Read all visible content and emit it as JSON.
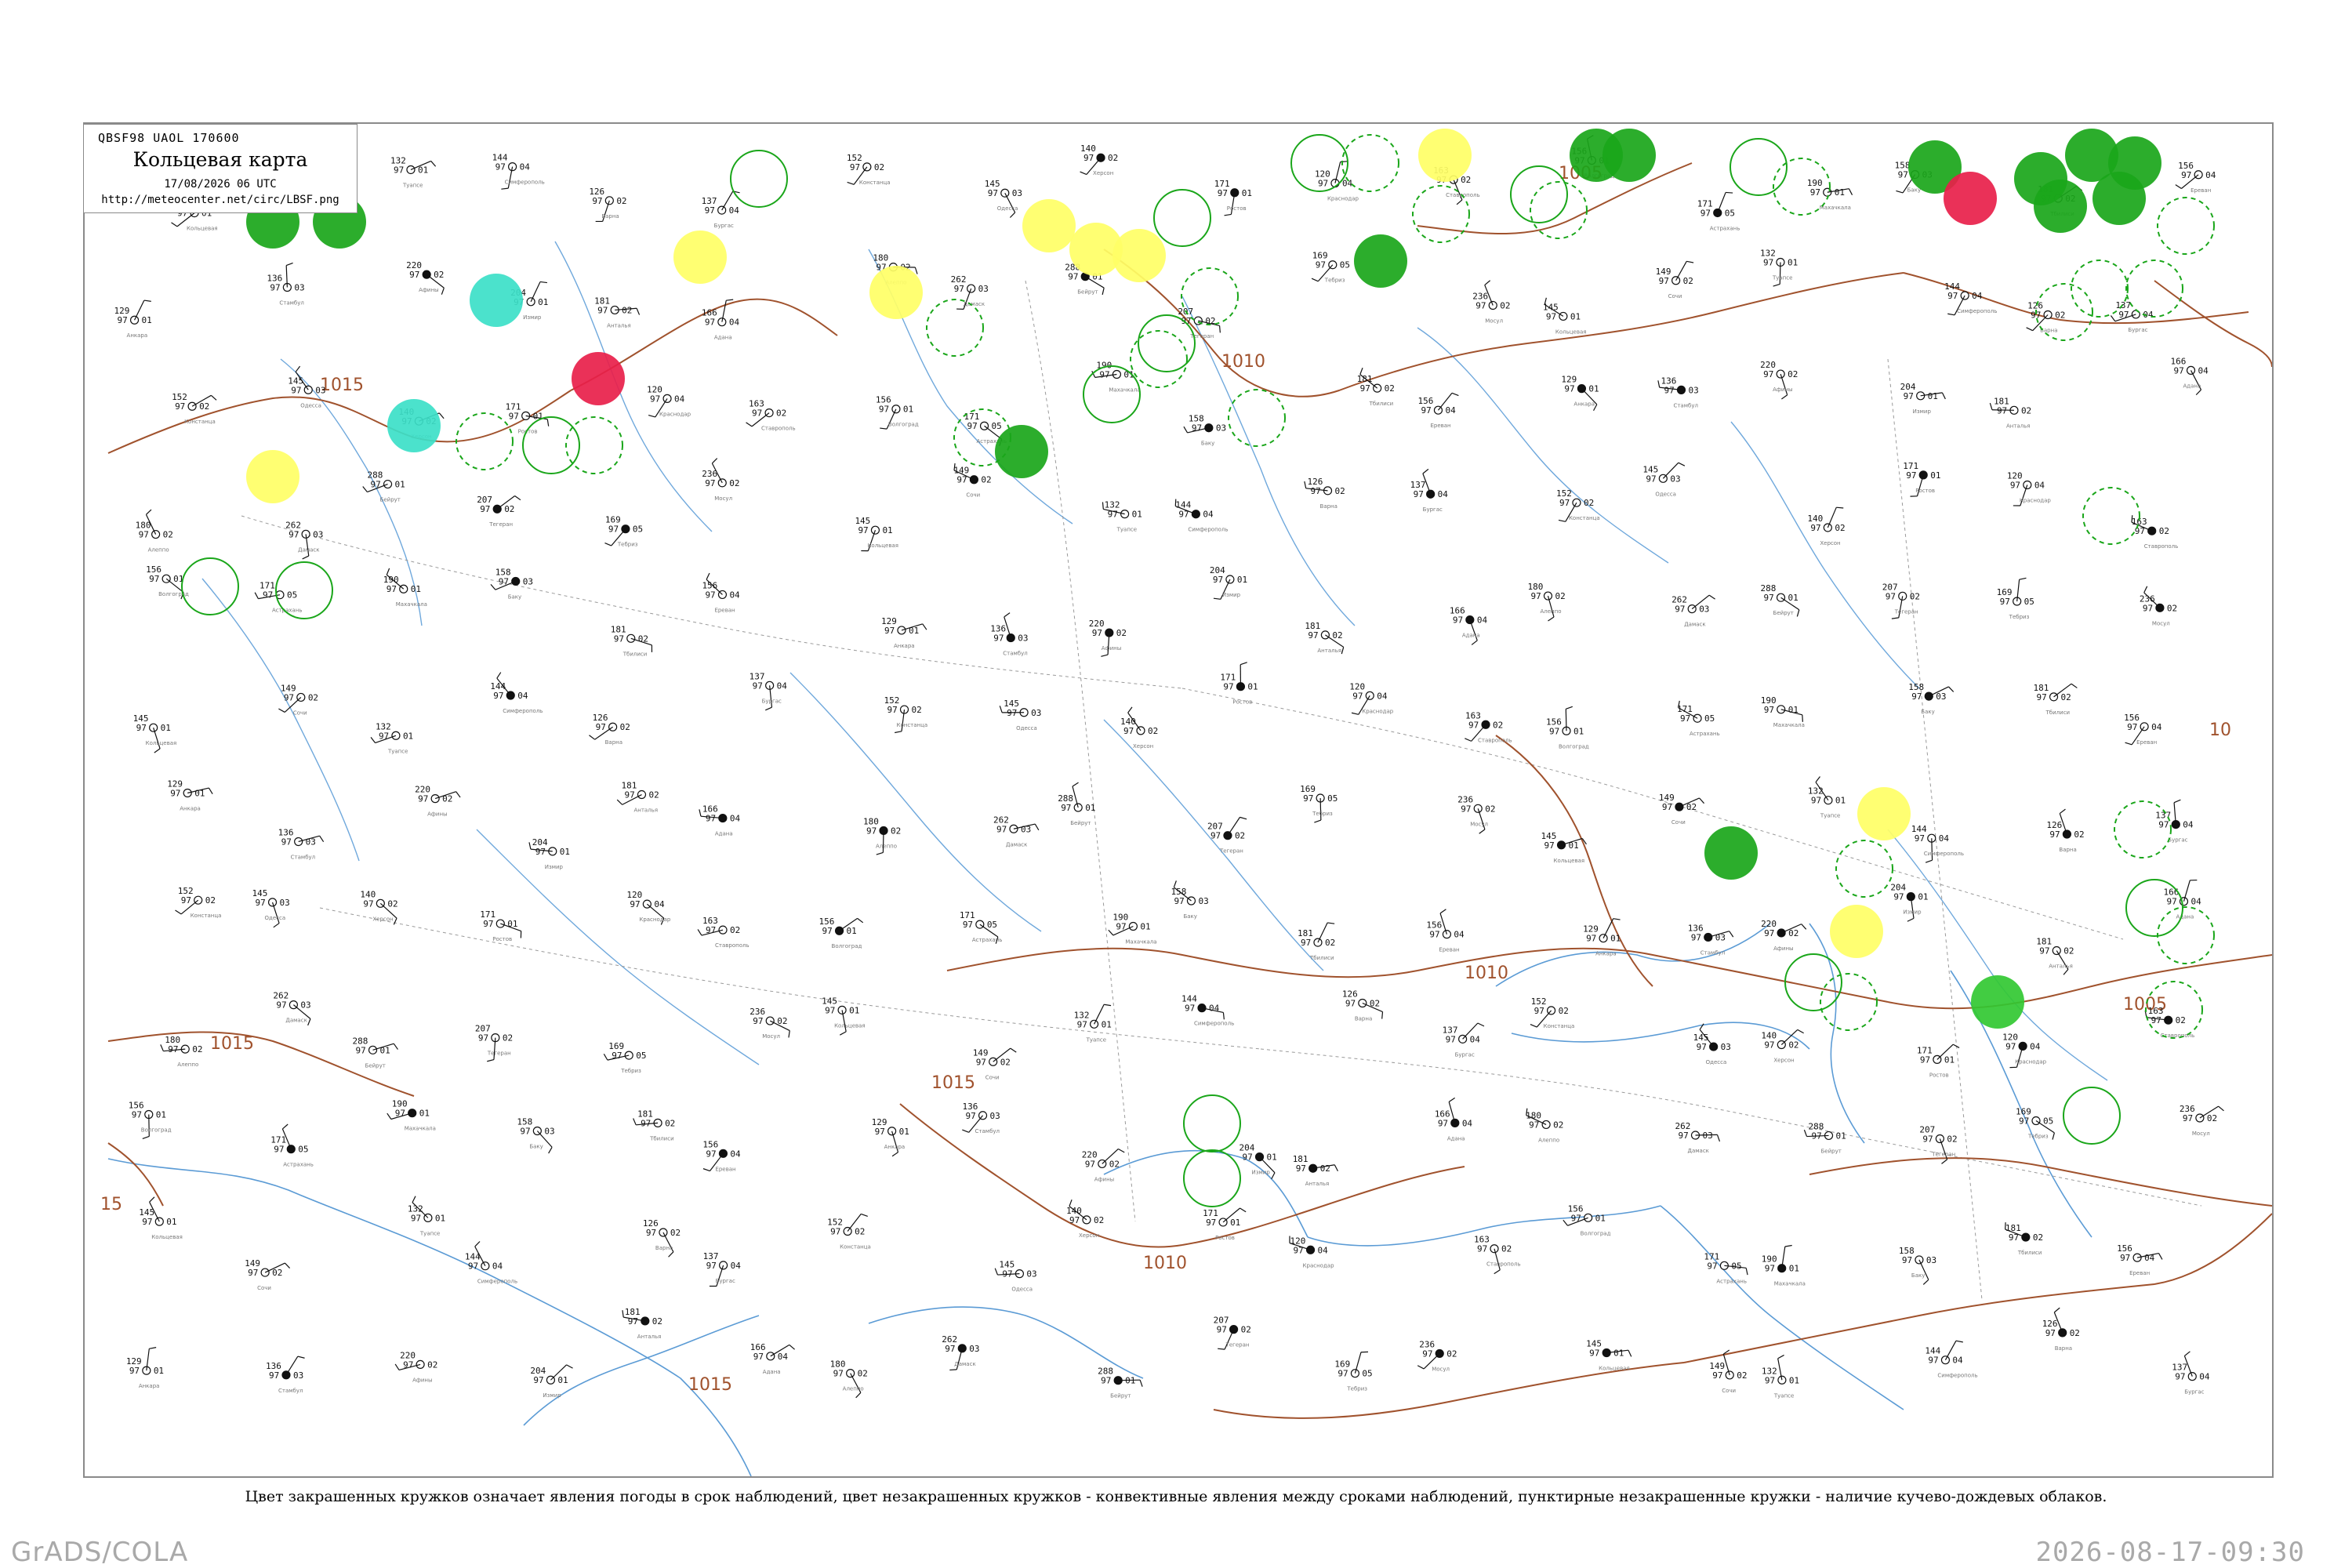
{
  "header": {
    "code": "QBSF98  UAOL  170600",
    "title": "Кольцевая карта",
    "datetime": "17/08/2026 06 UTC",
    "url": "http://meteocenter.net/circ/LBSF.png"
  },
  "map": {
    "isobar_labels": [
      "1015",
      "1015",
      "1010",
      "1005",
      "1010",
      "1015",
      "1010",
      "1005",
      "1015",
      "10",
      "15"
    ],
    "stations": [
      {
        "name": "Кольцевая",
        "temp": "145",
        "pressure": "97",
        "tendency": "01"
      },
      {
        "name": "Сочи",
        "temp": "149",
        "pressure": "97",
        "tendency": "02"
      },
      {
        "name": "Туапсе",
        "temp": "132",
        "pressure": "97",
        "tendency": "01"
      },
      {
        "name": "Симферополь",
        "temp": "144",
        "pressure": "97",
        "tendency": "04"
      },
      {
        "name": "Варна",
        "temp": "126",
        "pressure": "97",
        "tendency": "02"
      },
      {
        "name": "Бургас",
        "temp": "137",
        "pressure": "97",
        "tendency": "04"
      },
      {
        "name": "Констанца",
        "temp": "152",
        "pressure": "97",
        "tendency": "02"
      },
      {
        "name": "Одесса",
        "temp": "145",
        "pressure": "97",
        "tendency": "03"
      },
      {
        "name": "Херсон",
        "temp": "140",
        "pressure": "97",
        "tendency": "02"
      },
      {
        "name": "Ростов",
        "temp": "171",
        "pressure": "97",
        "tendency": "01"
      },
      {
        "name": "Краснодар",
        "temp": "120",
        "pressure": "97",
        "tendency": "04"
      },
      {
        "name": "Ставрополь",
        "temp": "163",
        "pressure": "97",
        "tendency": "02"
      },
      {
        "name": "Волгоград",
        "temp": "156",
        "pressure": "97",
        "tendency": "01"
      },
      {
        "name": "Астрахань",
        "temp": "171",
        "pressure": "97",
        "tendency": "05"
      },
      {
        "name": "Махачкала",
        "temp": "190",
        "pressure": "97",
        "tendency": "01"
      },
      {
        "name": "Баку",
        "temp": "158",
        "pressure": "97",
        "tendency": "03"
      },
      {
        "name": "Тбилиси",
        "temp": "181",
        "pressure": "97",
        "tendency": "02"
      },
      {
        "name": "Ереван",
        "temp": "156",
        "pressure": "97",
        "tendency": "04"
      },
      {
        "name": "Анкара",
        "temp": "129",
        "pressure": "97",
        "tendency": "01"
      },
      {
        "name": "Стамбул",
        "temp": "136",
        "pressure": "97",
        "tendency": "03"
      },
      {
        "name": "Афины",
        "temp": "220",
        "pressure": "97",
        "tendency": "02"
      },
      {
        "name": "Измир",
        "temp": "204",
        "pressure": "97",
        "tendency": "01"
      },
      {
        "name": "Анталья",
        "temp": "181",
        "pressure": "97",
        "tendency": "02"
      },
      {
        "name": "Адана",
        "temp": "166",
        "pressure": "97",
        "tendency": "04"
      },
      {
        "name": "Алеппо",
        "temp": "180",
        "pressure": "97",
        "tendency": "02"
      },
      {
        "name": "Дамаск",
        "temp": "262",
        "pressure": "97",
        "tendency": "03"
      },
      {
        "name": "Бейрут",
        "temp": "288",
        "pressure": "97",
        "tendency": "01"
      },
      {
        "name": "Тегеран",
        "temp": "207",
        "pressure": "97",
        "tendency": "02"
      },
      {
        "name": "Тебриз",
        "temp": "169",
        "pressure": "97",
        "tendency": "05"
      },
      {
        "name": "Мосул",
        "temp": "236",
        "pressure": "97",
        "tendency": "02"
      }
    ]
  },
  "legend_note": "Цвет закрашенных кружков означает явления погоды в срок наблюдений, цвет незакрашенных кружков - конвективные явления между сроками наблюдений, пунктирные незакрашенные кружки - наличие кучево-дождевых облаков.",
  "footer": {
    "left": "GrADS/COLA",
    "right": "2026-08-17-09:30"
  },
  "colors": {
    "isobar": "#a0522d",
    "river": "#6fa8dc",
    "rain": "#1aa61a",
    "shower": "#32c832",
    "drizzle": "#ffff66",
    "thunder": "#e8204a",
    "fog": "#3ce0c8"
  }
}
